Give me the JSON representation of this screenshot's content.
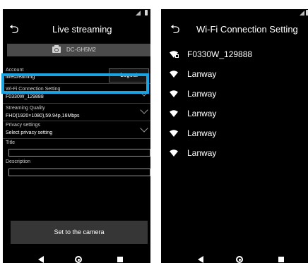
{
  "left": {
    "title": "Live streaming",
    "camera_model": "DC-GH5M2",
    "account": {
      "label": "Account",
      "value": "livestreaming",
      "logout": "Logout"
    },
    "wifi": {
      "label": "Wi-Fi Connection Setting",
      "value": "F0330W_129888"
    },
    "quality": {
      "label": "Streaming Quality",
      "value": "FHD(1920×1080),59.94p,16Mbps"
    },
    "privacy": {
      "label": "Privacy settings",
      "value": "Select privacy setting"
    },
    "title_field": {
      "label": "Title",
      "value": ""
    },
    "description_field": {
      "label": "Description",
      "value": ""
    },
    "set_button": "Set to the camera"
  },
  "right": {
    "title": "Wi-Fi Connection Setting",
    "networks": [
      {
        "name": "F0330W_129888",
        "secured": true
      },
      {
        "name": "Lanway",
        "secured": false
      },
      {
        "name": "Lanway",
        "secured": false
      },
      {
        "name": "Lanway",
        "secured": false
      },
      {
        "name": "Lanway",
        "secured": false
      },
      {
        "name": "Lanway",
        "secured": false
      }
    ]
  },
  "icons": {
    "back": "back-arrow-icon",
    "camera": "camera-icon",
    "chevron": "chevron-down-icon",
    "wifi": "wifi-icon",
    "nav_back": "nav-back-icon",
    "nav_home": "nav-home-icon",
    "nav_recent": "nav-recent-icon"
  },
  "colors": {
    "highlight": "#1aa3e0",
    "background": "#000000",
    "button": "#363636"
  }
}
